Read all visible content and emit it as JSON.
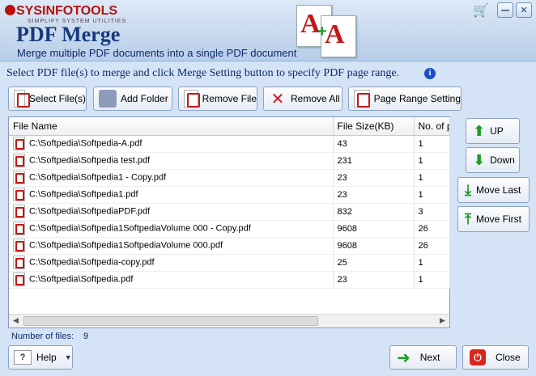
{
  "brand": {
    "logo_text": "SYSINFOTOOLS",
    "logo_sub": "SIMPLIFY SYSTEM UTILITIES"
  },
  "app": {
    "title": "PDF Merge",
    "subtitle": "Merge multiple PDF documents into a single PDF document"
  },
  "window_controls": {
    "minimize": "—",
    "close": "✕"
  },
  "instruction": "Select PDF file(s) to merge and click Merge Setting button to specify PDF page range.",
  "toolbar": {
    "select_files": "Select File(s)",
    "add_folder": "Add Folder",
    "remove_file": "Remove File",
    "remove_all": "Remove All",
    "page_range": "Page Range Setting"
  },
  "table": {
    "columns": [
      "File Name",
      "File Size(KB)",
      "No. of pa"
    ],
    "rows": [
      {
        "name": "C:\\Softpedia\\Softpedia-A.pdf",
        "size": "43",
        "pages": "1"
      },
      {
        "name": "C:\\Softpedia\\Softpedia test.pdf",
        "size": "231",
        "pages": "1"
      },
      {
        "name": "C:\\Softpedia\\Softpedia1 - Copy.pdf",
        "size": "23",
        "pages": "1"
      },
      {
        "name": "C:\\Softpedia\\Softpedia1.pdf",
        "size": "23",
        "pages": "1"
      },
      {
        "name": "C:\\Softpedia\\SoftpediaPDF.pdf",
        "size": "832",
        "pages": "3"
      },
      {
        "name": "C:\\Softpedia\\Softpedia1SoftpediaVolume 000 - Copy.pdf",
        "size": "9608",
        "pages": "26"
      },
      {
        "name": "C:\\Softpedia\\Softpedia1SoftpediaVolume 000.pdf",
        "size": "9608",
        "pages": "26"
      },
      {
        "name": "C:\\Softpedia\\Softpedia-copy.pdf",
        "size": "25",
        "pages": "1"
      },
      {
        "name": "C:\\Softpedia\\Softpedia.pdf",
        "size": "23",
        "pages": "1"
      }
    ]
  },
  "side": {
    "up": "UP",
    "down": "Down",
    "move_last": "Move Last",
    "move_first": "Move First"
  },
  "footer": {
    "count_label": "Number of files:",
    "count_value": "9",
    "help": "Help",
    "next": "Next",
    "close": "Close"
  },
  "colors": {
    "accent": "#163a7a",
    "pdf_red": "#c41818",
    "arrow_green": "#1e9b22"
  }
}
